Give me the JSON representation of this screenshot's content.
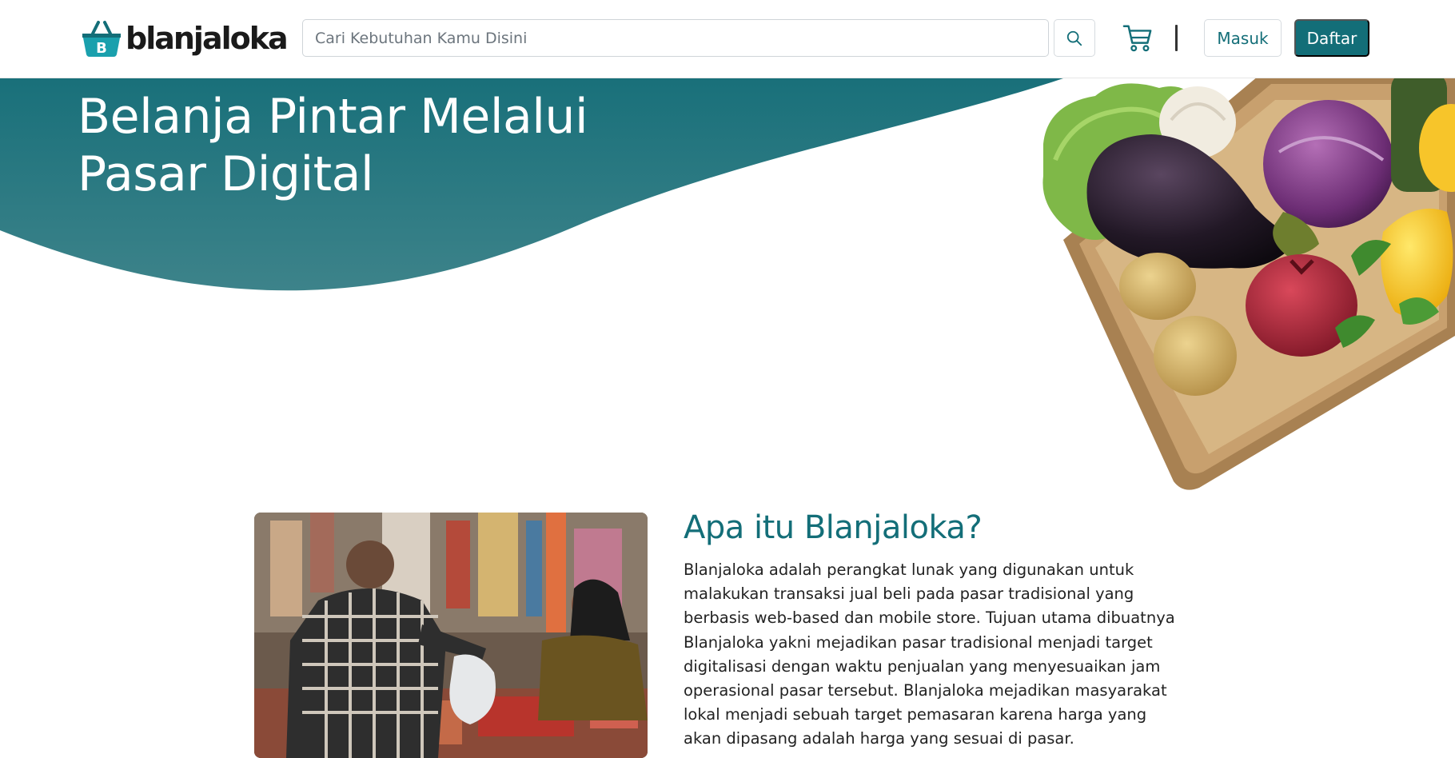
{
  "brand": {
    "name": "blanjaloka",
    "logo_letter": "B",
    "color_primary": "#136e78",
    "color_hero_top": "#19707a",
    "color_hero_bottom": "#3c8289"
  },
  "header": {
    "search_placeholder": "Cari Kebutuhan Kamu Disini",
    "search_icon": "search-icon",
    "cart_icon": "cart-icon",
    "login_label": "Masuk",
    "register_label": "Daftar"
  },
  "hero": {
    "title_line1": "Belanja Pintar Melalui",
    "title_line2": "Pasar Digital",
    "image": "vegetable-basket"
  },
  "about": {
    "title": "Apa itu Blanjaloka?",
    "image": "traditional-market-photo",
    "lines": [
      "Blanjaloka adalah perangkat lunak yang digunakan untuk",
      "malakukan transaksi jual beli pada pasar tradisional yang",
      "berbasis web-based dan mobile store. Tujuan utama dibuatnya",
      "Blanjaloka yakni mejadikan pasar tradisional menjadi target",
      "digitalisasi dengan waktu penjualan yang menyesuaikan jam",
      "operasional pasar tersebut. Blanjaloka mejadikan masyarakat",
      "lokal menjadi sebuah target pemasaran karena harga yang",
      "akan dipasang adalah harga yang sesuai di pasar."
    ]
  }
}
